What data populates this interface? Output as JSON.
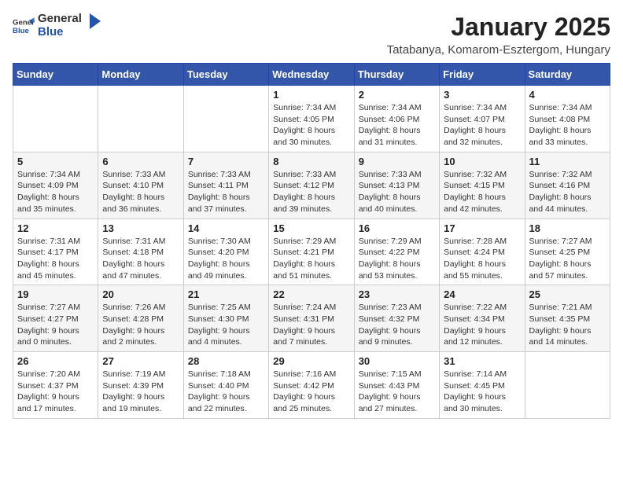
{
  "logo": {
    "general": "General",
    "blue": "Blue"
  },
  "header": {
    "month": "January 2025",
    "location": "Tatabanya, Komarom-Esztergom, Hungary"
  },
  "weekdays": [
    "Sunday",
    "Monday",
    "Tuesday",
    "Wednesday",
    "Thursday",
    "Friday",
    "Saturday"
  ],
  "weeks": [
    [
      {
        "day": "",
        "info": ""
      },
      {
        "day": "",
        "info": ""
      },
      {
        "day": "",
        "info": ""
      },
      {
        "day": "1",
        "info": "Sunrise: 7:34 AM\nSunset: 4:05 PM\nDaylight: 8 hours and 30 minutes."
      },
      {
        "day": "2",
        "info": "Sunrise: 7:34 AM\nSunset: 4:06 PM\nDaylight: 8 hours and 31 minutes."
      },
      {
        "day": "3",
        "info": "Sunrise: 7:34 AM\nSunset: 4:07 PM\nDaylight: 8 hours and 32 minutes."
      },
      {
        "day": "4",
        "info": "Sunrise: 7:34 AM\nSunset: 4:08 PM\nDaylight: 8 hours and 33 minutes."
      }
    ],
    [
      {
        "day": "5",
        "info": "Sunrise: 7:34 AM\nSunset: 4:09 PM\nDaylight: 8 hours and 35 minutes."
      },
      {
        "day": "6",
        "info": "Sunrise: 7:33 AM\nSunset: 4:10 PM\nDaylight: 8 hours and 36 minutes."
      },
      {
        "day": "7",
        "info": "Sunrise: 7:33 AM\nSunset: 4:11 PM\nDaylight: 8 hours and 37 minutes."
      },
      {
        "day": "8",
        "info": "Sunrise: 7:33 AM\nSunset: 4:12 PM\nDaylight: 8 hours and 39 minutes."
      },
      {
        "day": "9",
        "info": "Sunrise: 7:33 AM\nSunset: 4:13 PM\nDaylight: 8 hours and 40 minutes."
      },
      {
        "day": "10",
        "info": "Sunrise: 7:32 AM\nSunset: 4:15 PM\nDaylight: 8 hours and 42 minutes."
      },
      {
        "day": "11",
        "info": "Sunrise: 7:32 AM\nSunset: 4:16 PM\nDaylight: 8 hours and 44 minutes."
      }
    ],
    [
      {
        "day": "12",
        "info": "Sunrise: 7:31 AM\nSunset: 4:17 PM\nDaylight: 8 hours and 45 minutes."
      },
      {
        "day": "13",
        "info": "Sunrise: 7:31 AM\nSunset: 4:18 PM\nDaylight: 8 hours and 47 minutes."
      },
      {
        "day": "14",
        "info": "Sunrise: 7:30 AM\nSunset: 4:20 PM\nDaylight: 8 hours and 49 minutes."
      },
      {
        "day": "15",
        "info": "Sunrise: 7:29 AM\nSunset: 4:21 PM\nDaylight: 8 hours and 51 minutes."
      },
      {
        "day": "16",
        "info": "Sunrise: 7:29 AM\nSunset: 4:22 PM\nDaylight: 8 hours and 53 minutes."
      },
      {
        "day": "17",
        "info": "Sunrise: 7:28 AM\nSunset: 4:24 PM\nDaylight: 8 hours and 55 minutes."
      },
      {
        "day": "18",
        "info": "Sunrise: 7:27 AM\nSunset: 4:25 PM\nDaylight: 8 hours and 57 minutes."
      }
    ],
    [
      {
        "day": "19",
        "info": "Sunrise: 7:27 AM\nSunset: 4:27 PM\nDaylight: 9 hours and 0 minutes."
      },
      {
        "day": "20",
        "info": "Sunrise: 7:26 AM\nSunset: 4:28 PM\nDaylight: 9 hours and 2 minutes."
      },
      {
        "day": "21",
        "info": "Sunrise: 7:25 AM\nSunset: 4:30 PM\nDaylight: 9 hours and 4 minutes."
      },
      {
        "day": "22",
        "info": "Sunrise: 7:24 AM\nSunset: 4:31 PM\nDaylight: 9 hours and 7 minutes."
      },
      {
        "day": "23",
        "info": "Sunrise: 7:23 AM\nSunset: 4:32 PM\nDaylight: 9 hours and 9 minutes."
      },
      {
        "day": "24",
        "info": "Sunrise: 7:22 AM\nSunset: 4:34 PM\nDaylight: 9 hours and 12 minutes."
      },
      {
        "day": "25",
        "info": "Sunrise: 7:21 AM\nSunset: 4:35 PM\nDaylight: 9 hours and 14 minutes."
      }
    ],
    [
      {
        "day": "26",
        "info": "Sunrise: 7:20 AM\nSunset: 4:37 PM\nDaylight: 9 hours and 17 minutes."
      },
      {
        "day": "27",
        "info": "Sunrise: 7:19 AM\nSunset: 4:39 PM\nDaylight: 9 hours and 19 minutes."
      },
      {
        "day": "28",
        "info": "Sunrise: 7:18 AM\nSunset: 4:40 PM\nDaylight: 9 hours and 22 minutes."
      },
      {
        "day": "29",
        "info": "Sunrise: 7:16 AM\nSunset: 4:42 PM\nDaylight: 9 hours and 25 minutes."
      },
      {
        "day": "30",
        "info": "Sunrise: 7:15 AM\nSunset: 4:43 PM\nDaylight: 9 hours and 27 minutes."
      },
      {
        "day": "31",
        "info": "Sunrise: 7:14 AM\nSunset: 4:45 PM\nDaylight: 9 hours and 30 minutes."
      },
      {
        "day": "",
        "info": ""
      }
    ]
  ]
}
